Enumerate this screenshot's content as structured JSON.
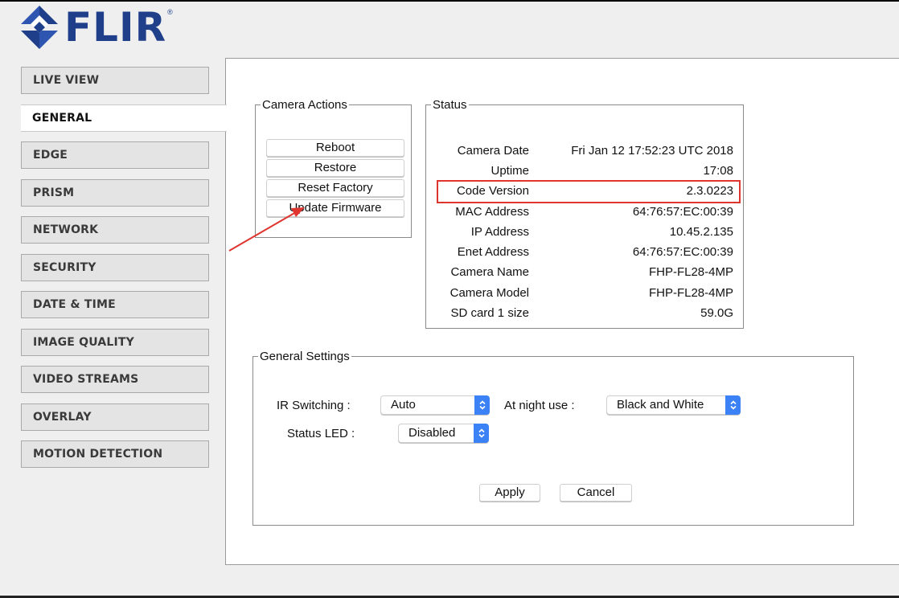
{
  "logo": {
    "text": "FLIR",
    "reg": "®"
  },
  "colors": {
    "brand": "#1f3f8b",
    "highlight": "#e0342f",
    "select_accent": "#3b82f6"
  },
  "nav": {
    "items": [
      {
        "label": "LIVE VIEW",
        "active": false
      },
      {
        "label": "GENERAL",
        "active": true
      },
      {
        "label": "EDGE",
        "active": false
      },
      {
        "label": "PRISM",
        "active": false
      },
      {
        "label": "NETWORK",
        "active": false
      },
      {
        "label": "SECURITY",
        "active": false
      },
      {
        "label": "DATE & TIME",
        "active": false
      },
      {
        "label": "IMAGE QUALITY",
        "active": false
      },
      {
        "label": "VIDEO STREAMS",
        "active": false
      },
      {
        "label": "OVERLAY",
        "active": false
      },
      {
        "label": "MOTION DETECTION",
        "active": false
      }
    ]
  },
  "camera_actions": {
    "legend": "Camera Actions",
    "buttons": [
      "Reboot",
      "Restore",
      "Reset Factory",
      "Update Firmware"
    ]
  },
  "status": {
    "legend": "Status",
    "rows": [
      {
        "label": "Camera Date",
        "value": "Fri Jan 12 17:52:23 UTC 2018"
      },
      {
        "label": "Uptime",
        "value": "17:08"
      },
      {
        "label": "Code Version",
        "value": "2.3.0223",
        "highlighted": true
      },
      {
        "label": "MAC Address",
        "value": "64:76:57:EC:00:39"
      },
      {
        "label": "IP Address",
        "value": "10.45.2.135"
      },
      {
        "label": "Enet Address",
        "value": "64:76:57:EC:00:39"
      },
      {
        "label": "Camera Name",
        "value": "FHP-FL28-4MP"
      },
      {
        "label": "Camera Model",
        "value": "FHP-FL28-4MP"
      },
      {
        "label": "SD card 1 size",
        "value": "59.0G"
      }
    ]
  },
  "general_settings": {
    "legend": "General Settings",
    "ir_switching": {
      "label": "IR Switching :",
      "value": "Auto"
    },
    "at_night": {
      "label": "At night use :",
      "value": "Black and White"
    },
    "status_led": {
      "label": "Status LED :",
      "value": "Disabled"
    },
    "apply_label": "Apply",
    "cancel_label": "Cancel"
  }
}
